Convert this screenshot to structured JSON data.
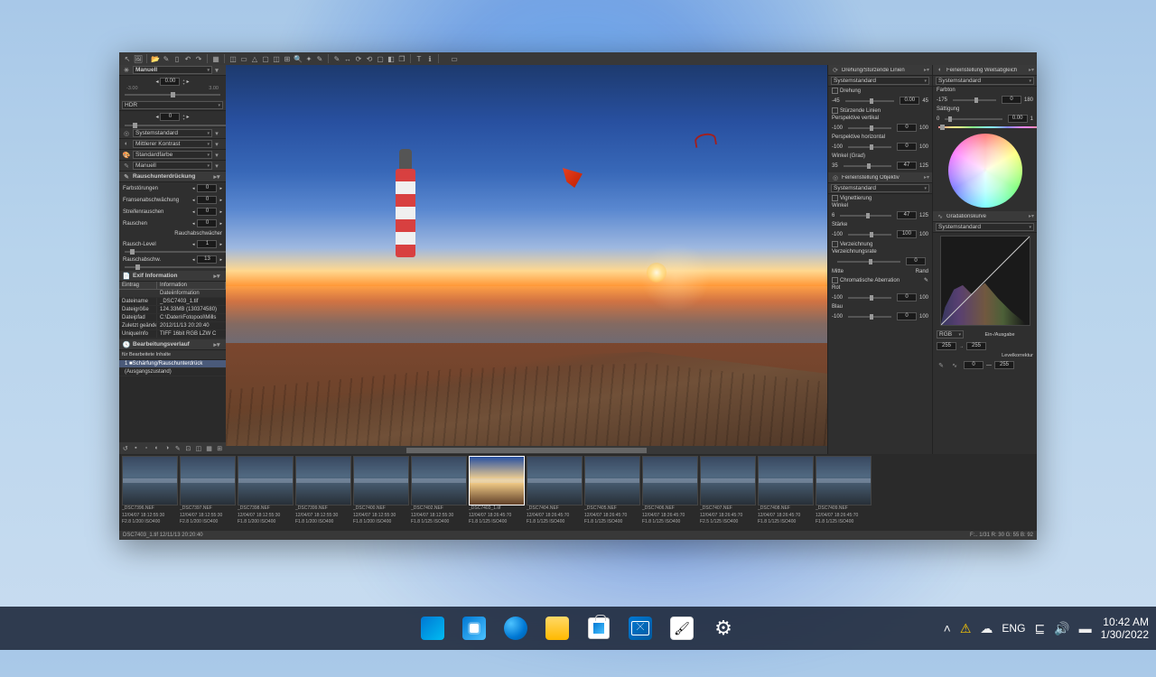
{
  "toolbar": {
    "icons": [
      "↖",
      "🖼",
      "",
      "📁",
      "🖌",
      "📄",
      "↶",
      "↷",
      "",
      "▦",
      "",
      "◫",
      "▭",
      "⚠",
      "▢",
      "◫",
      "⊞",
      "🔍",
      "✨",
      "✎",
      "",
      "✎",
      "⤢",
      "↗",
      "⟳",
      "⊡",
      "◫",
      "◧",
      "",
      "T",
      "ℹ",
      "",
      "▭"
    ]
  },
  "left": {
    "manual_label": "Manuell",
    "manual_value": "0.00",
    "manual_min": "-3.00",
    "manual_max": "3.00",
    "hdr_label": "HDR",
    "hdr_value": "0",
    "dropdowns": [
      {
        "label": "Systemstandard"
      },
      {
        "label": "Mittlerer Kontrast"
      },
      {
        "label": "Standardfarbe"
      },
      {
        "label": "Manuell"
      }
    ],
    "noise_header": "Rauschunterdrückung",
    "noise_rows": [
      {
        "label": "Farbstörungen",
        "value": "0"
      },
      {
        "label": "Fransenabschwächung",
        "value": "0"
      },
      {
        "label": "Streifenrauschen",
        "value": "0"
      },
      {
        "label": "Rauschen",
        "value": "0"
      }
    ],
    "noise_sub": "Rauchabschwächer",
    "noise_level": {
      "label": "Rausch-Level",
      "value": "1"
    },
    "noise_att": {
      "label": "Rauschabschw.",
      "value": "13"
    },
    "info_header": "Exif Information",
    "info_cols": [
      "Eintrag",
      "Information"
    ],
    "info_subhead": "Dateiinformation",
    "info_rows": [
      {
        "k": "Dateiname",
        "v": "_DSC7403_1.tif"
      },
      {
        "k": "Dateigröße",
        "v": "124.33MB (130374580)"
      },
      {
        "k": "Dateipfad",
        "v": "C:\\Daten\\Fotopool\\Mills"
      },
      {
        "k": "Zuletzt geände",
        "v": "2012/11/13 20:20:40"
      },
      {
        "k": "UniqueInfo",
        "v": "TIFF 16bit RGB LZW C"
      }
    ],
    "history_header": "Bearbeitungsverlauf",
    "history_mode": "für Bearbeitete Inhalte",
    "history_items": [
      {
        "num": "1",
        "label": "■Schärfung/Rauschunterdrück",
        "sel": true
      },
      {
        "num": "",
        "label": "(Ausgangszustand)",
        "sel": false
      }
    ]
  },
  "right1": {
    "rotation_header": "Drehung/Stürzende Linien",
    "std": "Systemstandard",
    "rotation": {
      "label": "Drehung",
      "min": "-45",
      "max": "45",
      "value": "0.00"
    },
    "converge": "Stürzende Linien",
    "persp_v": {
      "label": "Perspektive vertikal",
      "min": "-100",
      "max": "100",
      "value": "0"
    },
    "persp_h": {
      "label": "Perspektive horizontal",
      "min": "-100",
      "max": "100",
      "value": "0"
    },
    "angle": {
      "label": "Winkel (Grad)",
      "min": "35",
      "max": "125",
      "value": "47"
    },
    "obj_header": "Feineinstellung Objektiv",
    "vign": {
      "label": "Vignettierung"
    },
    "vign_angle": {
      "label": "Winkel",
      "min": "6",
      "max": "125",
      "value": "47"
    },
    "strength": {
      "label": "Stärke",
      "min": "-100",
      "max": "100",
      "value": "100"
    },
    "distortion": {
      "label": "Verzeichnung"
    },
    "dist_rate": {
      "label": "Verzeichnungsrate",
      "min": "",
      "max": "",
      "value": "0"
    },
    "dist_range": {
      "left": "Mitte",
      "right": "Rand"
    },
    "ca": {
      "label": "Chromatische Aberration"
    },
    "ca_r": {
      "label": "Rot",
      "min": "-100",
      "max": "100",
      "value": "0"
    },
    "ca_b": {
      "label": "Blau",
      "min": "-100",
      "max": "100",
      "value": "0"
    }
  },
  "right2": {
    "wb_header": "Feineinstellung Weißabgleich",
    "std": "Systemstandard",
    "hue": {
      "label": "Farbton",
      "min": "-175",
      "max": "180",
      "value": "0"
    },
    "sat": {
      "label": "Sättigung",
      "min": "0",
      "max": "1",
      "value": "0.00"
    },
    "curves_header": "Gradationskurve",
    "rgb_label": "RGB",
    "io_label": "Ein-/Ausgabe",
    "io_in": "255",
    "io_out": "255",
    "level_label": "Levelkorrektur",
    "lvl_lo": "0",
    "lvl_hi": "255"
  },
  "thumbs": [
    {
      "name": "_DSC7396.NEF",
      "meta": "12/04/07 18:12:55:30",
      "exp": "F2.8 1/200 ISO400"
    },
    {
      "name": "_DSC7397.NEF",
      "meta": "12/04/07 18:12:55:30",
      "exp": "F2.8 1/200 ISO400"
    },
    {
      "name": "_DSC7398.NEF",
      "meta": "12/04/07 18:12:55:30",
      "exp": "F1.8 1/200 ISO400"
    },
    {
      "name": "_DSC7399.NEF",
      "meta": "12/04/07 18:12:55:30",
      "exp": "F1.8 1/200 ISO400"
    },
    {
      "name": "_DSC7400.NEF",
      "meta": "12/04/07 18:12:55:30",
      "exp": "F1.8 1/200 ISO400"
    },
    {
      "name": "_DSC7402.NEF",
      "meta": "12/04/07 18:12:55:30",
      "exp": "F1.8 1/125 ISO400"
    },
    {
      "name": "_DSC7403_1.tif",
      "meta": "12/04/07 18:26:45:70",
      "exp": "F1.8 1/125 ISO400",
      "sel": true
    },
    {
      "name": "_DSC7404.NEF",
      "meta": "12/04/07 18:26:45:70",
      "exp": "F1.8 1/125 ISO400"
    },
    {
      "name": "_DSC7405.NEF",
      "meta": "12/04/07 18:26:45:70",
      "exp": "F1.8 1/125 ISO400"
    },
    {
      "name": "_DSC7406.NEF",
      "meta": "12/04/07 18:26:45:70",
      "exp": "F1.8 1/125 ISO400"
    },
    {
      "name": "_DSC7407.NEF",
      "meta": "12/04/07 18:26:45:70",
      "exp": "F2.5 1/125 ISO400"
    },
    {
      "name": "_DSC7408.NEF",
      "meta": "12/04/07 18:26:45:70",
      "exp": "F1.8 1/125 ISO400"
    },
    {
      "name": "_DSC7409.NEF",
      "meta": "12/04/07 18:26:45:70",
      "exp": "F1.8 1/125 ISO400"
    }
  ],
  "status": {
    "left": "DSC7403_1.tif 12/11/13 20:20:40",
    "right": "F:.. 1/31 R: 30 G: 55 B: 92"
  },
  "taskbar": {
    "tray_lang": "ENG",
    "time": "10:42 AM",
    "date": "1/30/2022"
  }
}
